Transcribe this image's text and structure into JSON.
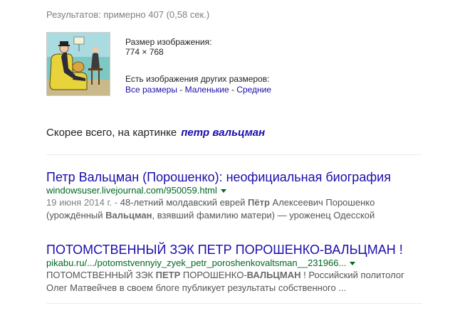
{
  "stats": "Результатов: примерно 407 (0,58 сек.)",
  "image_info": {
    "size_label": "Размер изображения:",
    "size_value": "774 × 768",
    "other_sizes_label": "Есть изображения других размеров:",
    "links": [
      "Все размеры",
      "Маленькие",
      "Средние"
    ],
    "separator": " - "
  },
  "best_guess": {
    "prefix": "Скорее всего, на картинке",
    "query": "петр вальцман"
  },
  "results": [
    {
      "title": "Петр Вальцман (Порошенко): неофициальная биография",
      "url": "windowsuser.livejournal.com/950059.html",
      "snippet_lines": [
        [
          {
            "t": "19 июня 2014 г. - ",
            "s": "date"
          },
          {
            "t": "48-летний молдавский еврей ",
            "s": ""
          },
          {
            "t": "Пётр",
            "s": "b"
          },
          {
            "t": " Алексеевич Порошенко",
            "s": ""
          }
        ],
        [
          {
            "t": "(урождённый ",
            "s": ""
          },
          {
            "t": "Вальцман",
            "s": "b"
          },
          {
            "t": ", взявший фамилию матери) — уроженец Одесской",
            "s": ""
          }
        ]
      ]
    },
    {
      "title": "ПОТОМСТВЕННЫЙ ЗЭК ПЕТР ПОРОШЕНКО-ВАЛЬЦМАН !",
      "url": "pikabu.ru/.../potomstvennyiy_zyek_petr_poroshenkovaltsman__231966...",
      "snippet_lines": [
        [
          {
            "t": "ПОТОМСТВЕННЫЙ ЗЭК ",
            "s": ""
          },
          {
            "t": "ПЕТР",
            "s": "b"
          },
          {
            "t": " ПОРОШЕНКО-",
            "s": ""
          },
          {
            "t": "ВАЛЬЦМАН",
            "s": "b"
          },
          {
            "t": " ! Российский политолог",
            "s": ""
          }
        ],
        [
          {
            "t": "Олег Матвейчев в своем блоге публикует результаты собственного ...",
            "s": ""
          }
        ]
      ]
    }
  ],
  "colors": {
    "link": "#1a0dab",
    "url_green": "#006621",
    "snippet": "#545454",
    "muted": "#808080"
  }
}
